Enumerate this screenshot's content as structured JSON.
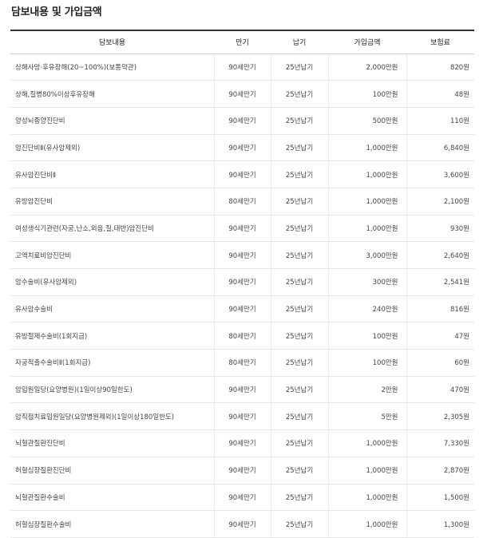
{
  "title": "담보내용 및 가입금액",
  "headers": [
    "담보내용",
    "만기",
    "납기",
    "가입금액",
    "보험료"
  ],
  "rows": [
    {
      "name": "상해사망·후유장해(20~100%)(보통약관)",
      "term": "90세만기",
      "pay": "25년납기",
      "amount": "2,000만원",
      "premium": "820원"
    },
    {
      "name": "상해,질병80%이상후유장해",
      "term": "90세만기",
      "pay": "25년납기",
      "amount": "100만원",
      "premium": "48원"
    },
    {
      "name": "양성뇌종양진단비",
      "term": "90세만기",
      "pay": "25년납기",
      "amount": "500만원",
      "premium": "110원"
    },
    {
      "name": "암진단비Ⅱ(유사암제외)",
      "term": "90세만기",
      "pay": "25년납기",
      "amount": "1,000만원",
      "premium": "6,840원"
    },
    {
      "name": "유사암진단비Ⅱ",
      "term": "90세만기",
      "pay": "25년납기",
      "amount": "1,000만원",
      "premium": "3,600원"
    },
    {
      "name": "유방암진단비",
      "term": "80세만기",
      "pay": "25년납기",
      "amount": "1,000만원",
      "premium": "2,100원"
    },
    {
      "name": "여성생식기관련(자궁,난소,외음,질,태반)암진단비",
      "term": "90세만기",
      "pay": "25년납기",
      "amount": "1,000만원",
      "premium": "930원"
    },
    {
      "name": "고액치료비암진단비",
      "term": "90세만기",
      "pay": "25년납기",
      "amount": "3,000만원",
      "premium": "2,640원"
    },
    {
      "name": "암수술비(유사암제외)",
      "term": "90세만기",
      "pay": "25년납기",
      "amount": "300만원",
      "premium": "2,541원"
    },
    {
      "name": "유사암수술비",
      "term": "90세만기",
      "pay": "25년납기",
      "amount": "240만원",
      "premium": "816원"
    },
    {
      "name": "유방절제수술비(1회지급)",
      "term": "80세만기",
      "pay": "25년납기",
      "amount": "100만원",
      "premium": "47원"
    },
    {
      "name": "자궁적출수술비Ⅱ(1회지급)",
      "term": "80세만기",
      "pay": "25년납기",
      "amount": "100만원",
      "premium": "60원"
    },
    {
      "name": "암입원일당(요양병원)(1일이상90일한도)",
      "term": "90세만기",
      "pay": "25년납기",
      "amount": "2만원",
      "premium": "470원"
    },
    {
      "name": "암직접치료입원일당(요양병원제외)(1일이상180일한도)",
      "term": "90세만기",
      "pay": "25년납기",
      "amount": "5만원",
      "premium": "2,305원"
    },
    {
      "name": "뇌혈관질환진단비",
      "term": "90세만기",
      "pay": "25년납기",
      "amount": "1,000만원",
      "premium": "7,330원"
    },
    {
      "name": "허혈심장질환진단비",
      "term": "90세만기",
      "pay": "25년납기",
      "amount": "1,000만원",
      "premium": "2,870원"
    },
    {
      "name": "뇌혈관질환수술비",
      "term": "90세만기",
      "pay": "25년납기",
      "amount": "1,000만원",
      "premium": "1,500원"
    },
    {
      "name": "허혈심장질환수술비",
      "term": "90세만기",
      "pay": "25년납기",
      "amount": "1,000만원",
      "premium": "1,300원"
    }
  ]
}
